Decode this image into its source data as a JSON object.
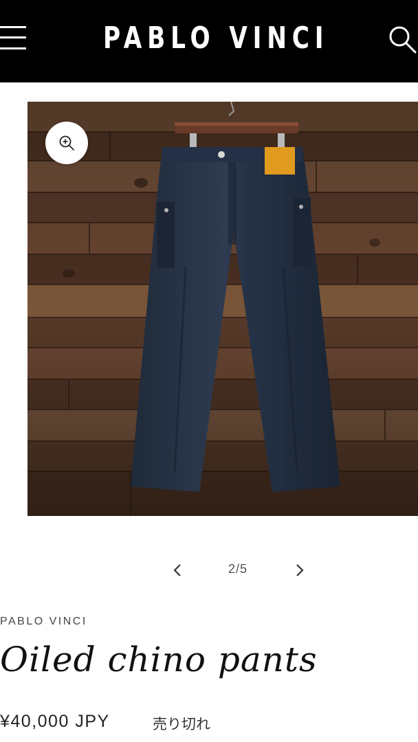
{
  "header": {
    "brand": "PABLO VINCI",
    "menu_icon": "hamburger-menu-icon",
    "search_icon": "search-icon",
    "background": "#000000"
  },
  "gallery": {
    "zoom_icon": "zoom-in-icon",
    "prev_icon": "chevron-left-icon",
    "next_icon": "chevron-right-icon",
    "counter": "2/5"
  },
  "product": {
    "vendor": "PABLO VINCI",
    "title": "Oiled chino pants",
    "price": "¥40,000 JPY",
    "status": "売り切れ"
  }
}
